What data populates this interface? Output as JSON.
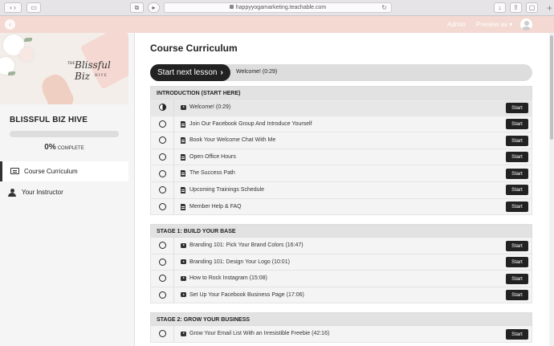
{
  "browser": {
    "url": "happyyogamarketing.teachable.com"
  },
  "topbar": {
    "admin": "Admin",
    "preview": "Preview as ▾"
  },
  "sidebar": {
    "hero": {
      "logo_the": "THE",
      "logo_main": "Blissful Biz",
      "logo_hive": "HIVE"
    },
    "course_title": "BLISSFUL BIZ HIVE",
    "progress": {
      "percent_value": 0,
      "percent": "0%",
      "label": "COMPLETE"
    },
    "nav": [
      {
        "label": "Course Curriculum",
        "icon": "book-icon",
        "active": true
      },
      {
        "label": "Your Instructor",
        "icon": "user-icon",
        "active": false
      }
    ]
  },
  "main": {
    "title": "Course Curriculum",
    "next": {
      "button": "Start next lesson",
      "arrow": "›",
      "lesson": "Welcome! (0:29)"
    },
    "start_label": "Start",
    "sections": [
      {
        "title": "INTRODUCTION (START HERE)",
        "lectures": [
          {
            "title": "Welcome! (0:29)",
            "type": "video",
            "current": true
          },
          {
            "title": "Join Our Facebook Group And Introduce Yourself",
            "type": "text"
          },
          {
            "title": "Book Your Welcome Chat With Me",
            "type": "text"
          },
          {
            "title": "Open Office Hours",
            "type": "text"
          },
          {
            "title": "The Success Path",
            "type": "text"
          },
          {
            "title": "Upcoming Trainings Schedule",
            "type": "text"
          },
          {
            "title": "Member Help & FAQ",
            "type": "text"
          }
        ]
      },
      {
        "title": "STAGE 1: BUILD YOUR BASE",
        "lectures": [
          {
            "title": "Branding 101: Pick Your Brand Colors (16:47)",
            "type": "video"
          },
          {
            "title": "Branding 101: Design Your Logo (10:01)",
            "type": "video"
          },
          {
            "title": "How to Rock Instagram (15:08)",
            "type": "video"
          },
          {
            "title": "Set Up Your Facebook Business Page (17:06)",
            "type": "video"
          }
        ]
      },
      {
        "title": "STAGE 2: GROW YOUR BUSINESS",
        "lectures": [
          {
            "title": "Grow Your Email List With an Irresistible Freebie (42:16)",
            "type": "video"
          }
        ]
      }
    ]
  }
}
